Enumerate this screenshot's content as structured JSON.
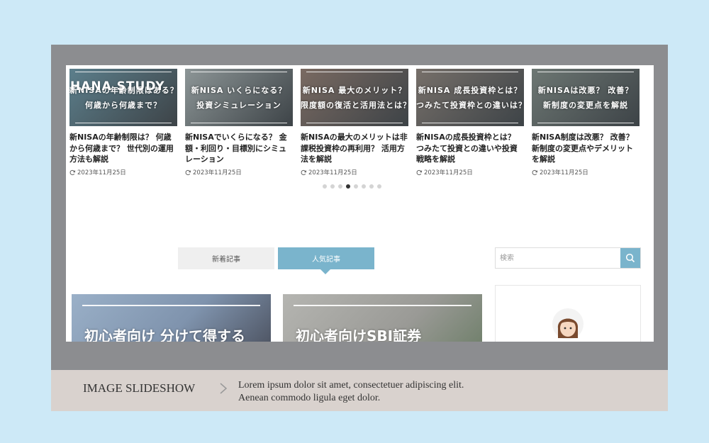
{
  "site": {
    "logo": "HANA STUDY"
  },
  "slider": {
    "cards": [
      {
        "img_line1": "新NISAの年齢制限はある？",
        "img_line2": "何歳から何歳まで？",
        "title": "新NISAの年齢制限は？ 何歳から何歳まで？ 世代別の運用方法も解説",
        "date": "2023年11月25日",
        "bg": "#5c7f8c"
      },
      {
        "img_line1": "新NISA いくらになる？",
        "img_line2": "投資シミュレーション",
        "title": "新NISAでいくらになる？ 金額・利回り・目標別にシミュレーション",
        "date": "2023年11月25日",
        "bg": "#8d9697"
      },
      {
        "img_line1": "新NISA 最大のメリット？",
        "img_line2": "限度額の復活と活用法とは？",
        "title": "新NISAの最大のメリットは非課税投資枠の再利用？ 活用方法を解説",
        "date": "2023年11月25日",
        "bg": "#7a6a62"
      },
      {
        "img_line1": "新NISA 成長投資枠とは？",
        "img_line2": "つみたて投資枠との違いは？",
        "title": "新NISAの成長投資枠とは？ つみたて投資との違いや投資戦略を解説",
        "date": "2023年11月25日",
        "bg": "#77706a"
      },
      {
        "img_line1": "新NISAは改悪？ 改善？",
        "img_line2": "新制度の変更点を解説",
        "title": "新NISA制度は改悪？ 改善？ 新制度の変更点やデメリットを解説",
        "date": "2023年11月25日",
        "bg": "#6d7773"
      }
    ],
    "dots": 8,
    "active_dot": 3
  },
  "tabs": {
    "new_label": "新着記事",
    "popular_label": "人気記事"
  },
  "search": {
    "placeholder": "検索"
  },
  "posts": [
    {
      "title": "初心者向け 分けて得する",
      "bg": "#8fa3bb"
    },
    {
      "title": "初心者向けSBI証券",
      "bg": "#a7a7a4"
    }
  ],
  "caption": {
    "label": "IMAGE SLIDESHOW",
    "line1": "Lorem ipsum dolor sit amet, consectetuer adipiscing elit.",
    "line2": "Aenean commodo ligula eget dolor."
  },
  "colors": {
    "accent": "#7ab4cc",
    "frame": "#8c8d90",
    "bar": "#d9d2ce",
    "page_bg": "#cde9f7"
  },
  "icons": {
    "search": "search-icon",
    "chevron": "chevron-right-icon",
    "refresh": "refresh-icon"
  }
}
